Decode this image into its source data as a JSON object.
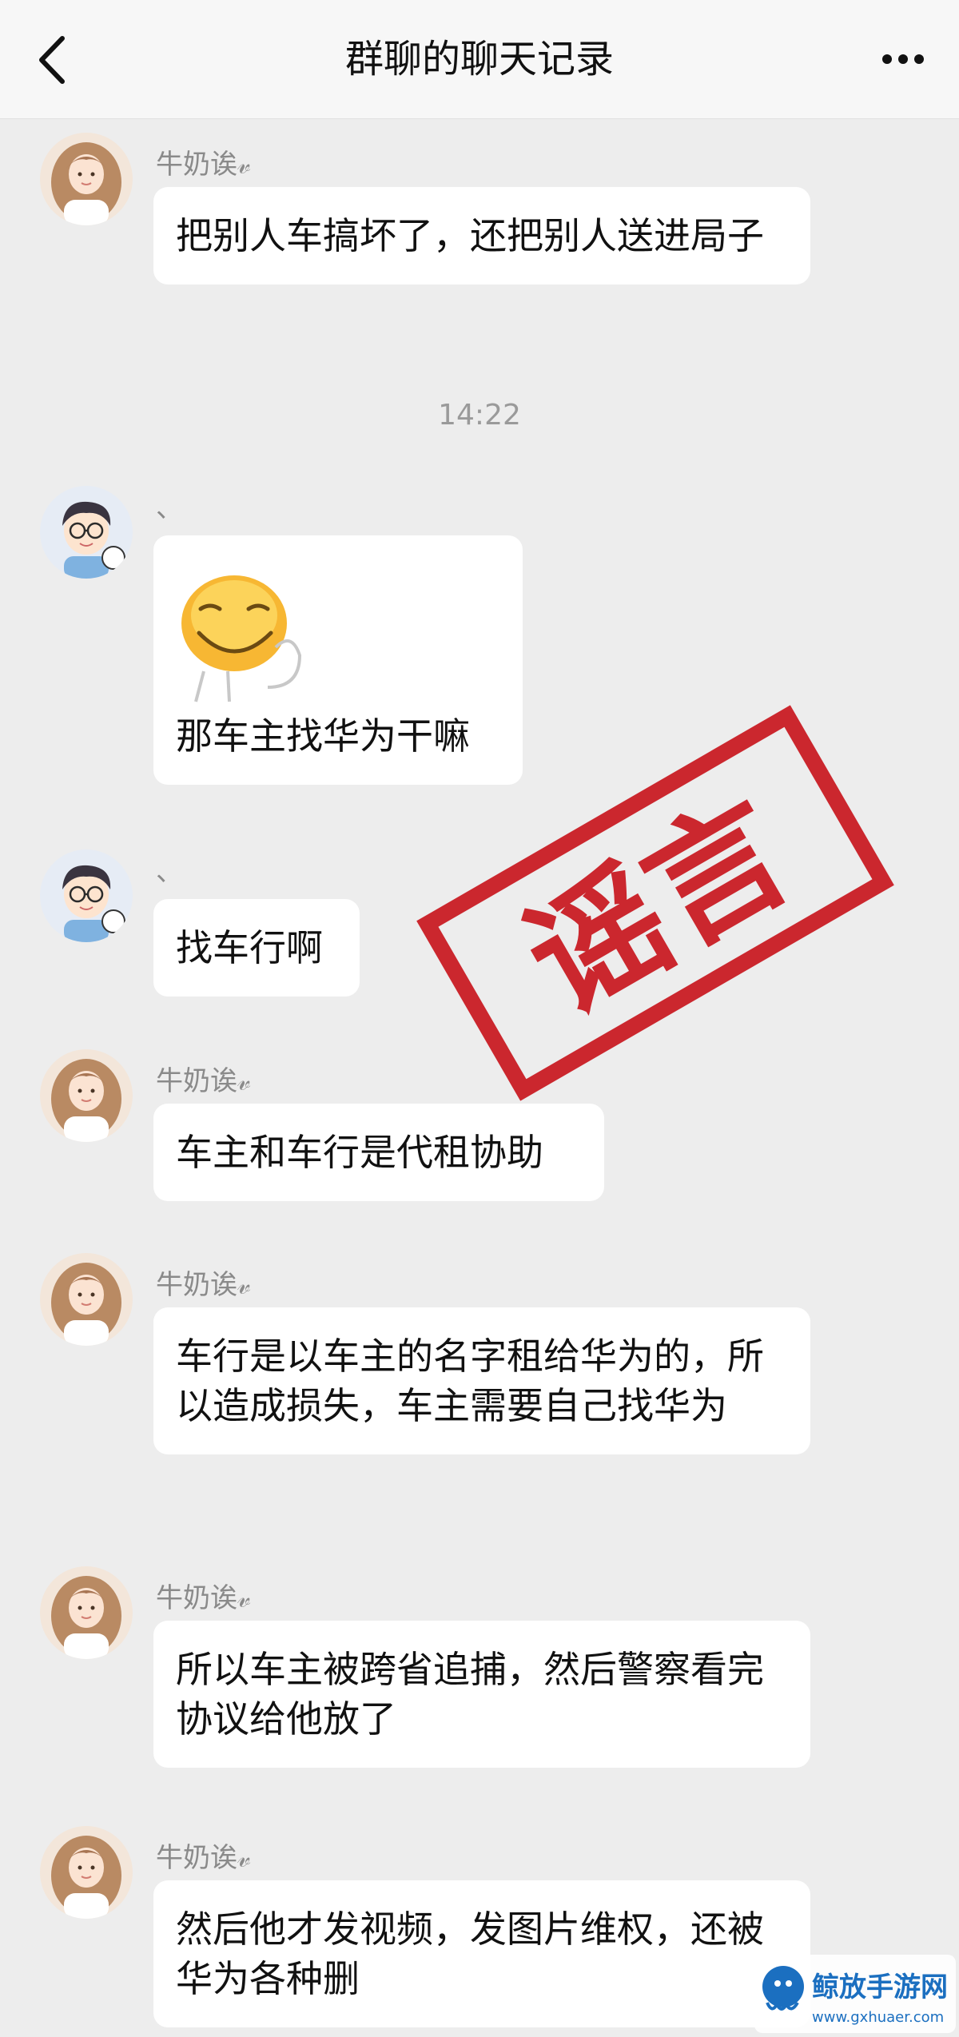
{
  "header": {
    "title": "群聊的聊天记录",
    "back_icon": "chevron-left-icon",
    "more_icon": "more-horizontal-icon"
  },
  "chat": {
    "time_divider": "14:22",
    "messages": [
      {
        "sender": "牛奶诶𝓋",
        "text": "把别人车搞坏了，还把别人送进局子"
      },
      {
        "sender": "、",
        "sticker": "grinning-face-sticker",
        "text": "那车主找华为干嘛"
      },
      {
        "sender": "、",
        "text": "找车行啊"
      },
      {
        "sender": "牛奶诶𝓋",
        "text": "车主和车行是代租协助"
      },
      {
        "sender": "牛奶诶𝓋",
        "text": "车行是以车主的名字租给华为的，所以造成损失，车主需要自己找华为"
      },
      {
        "sender": "牛奶诶𝓋",
        "text": "所以车主被跨省追捕，然后警察看完协议给他放了"
      },
      {
        "sender": "牛奶诶𝓋",
        "text": "然后他才发视频，发图片维权，还被华为各种删"
      }
    ]
  },
  "stamp": {
    "text": "谣言",
    "color": "#c8121a"
  },
  "watermark": {
    "text": "鲸放手游网",
    "url_text": "www.gxhuaer.com",
    "color": "#1b6fc0"
  },
  "colors": {
    "background": "#ededed",
    "bubble": "#ffffff",
    "accent": "#c8121a"
  }
}
